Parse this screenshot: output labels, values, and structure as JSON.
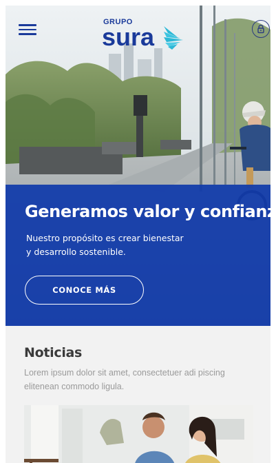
{
  "header": {
    "menu_icon": "hamburger-menu-icon",
    "logo": {
      "top": "GRUPO",
      "main": "sura",
      "mark_color": "#2bb8d6"
    },
    "user_icon": "user-lock-icon"
  },
  "hero": {
    "title": "Generamos valor y confianza",
    "subtitle_line1": "Nuestro propósito es crear bienestar",
    "subtitle_line2": "y desarrollo sostenible.",
    "cta_label": "CONOCE MÁS",
    "panel_color": "#1a3fa8"
  },
  "news": {
    "title": "Noticias",
    "description": "Lorem ipsum dolor sit amet, consectetuer adi piscing elitenean commodo ligula."
  },
  "colors": {
    "brand_blue": "#1a3a9a",
    "accent_cyan": "#2bb8d6",
    "muted_text": "#9a9a9a"
  }
}
